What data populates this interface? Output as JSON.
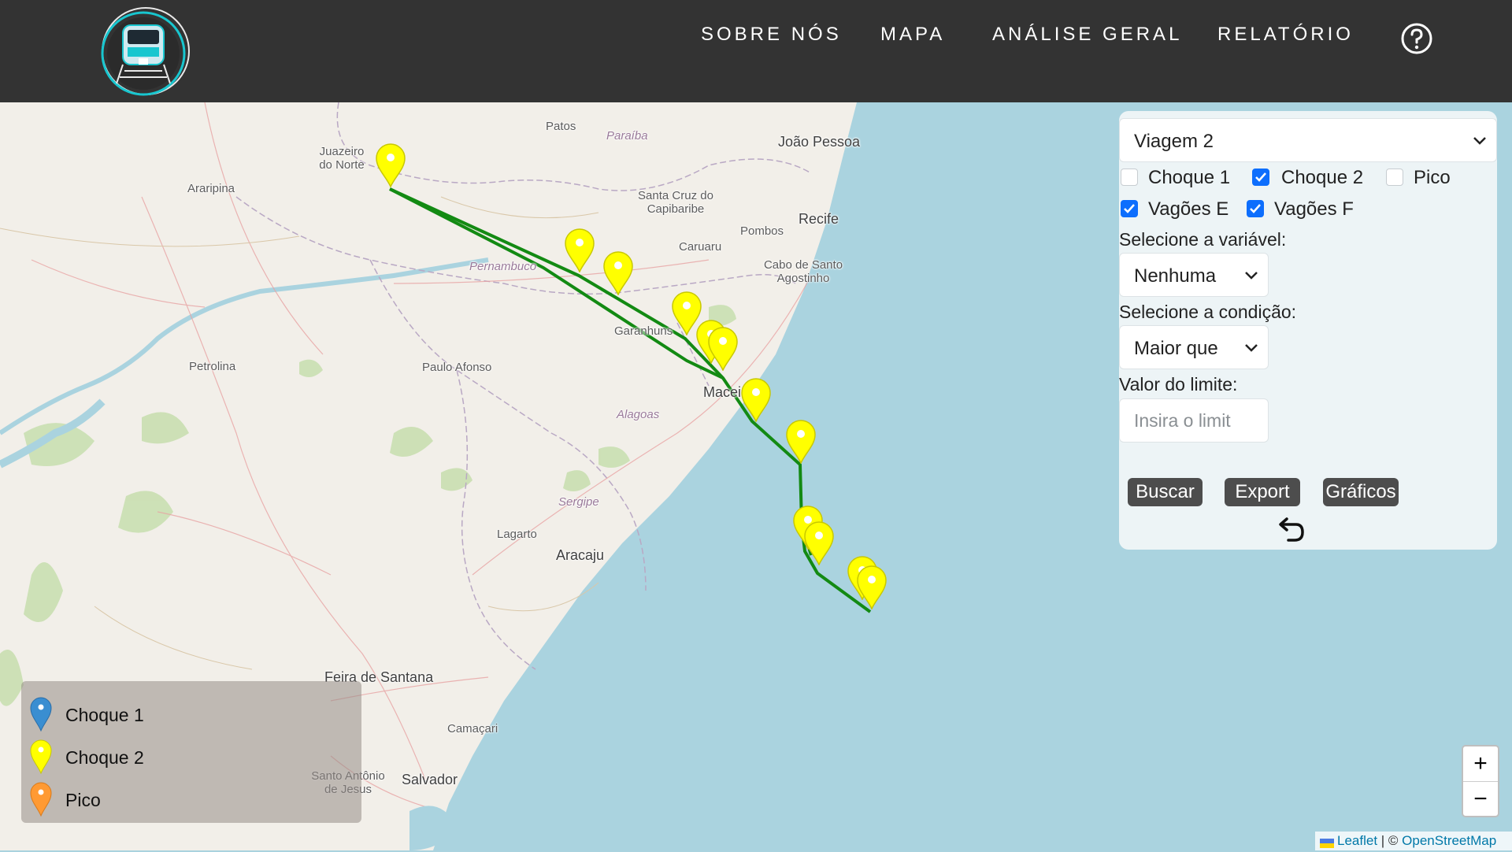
{
  "nav": {
    "items": [
      "SOBRE NÓS",
      "MAPA",
      "ANÁLISE GERAL",
      "RELATÓRIO"
    ],
    "help_icon": "question-circle-icon",
    "logo_icon": "train-logo-icon"
  },
  "map": {
    "places": {
      "patos": "Patos",
      "paraiba": "Paraíba",
      "joao_pessoa": "João Pessoa",
      "juazeiro": "Juazeiro do Norte",
      "araripina": "Araripina",
      "santa_cruz": "Santa Cruz do Capibaribe",
      "recife": "Recife",
      "pombos": "Pombos",
      "caruaru": "Caruaru",
      "cabo": "Cabo de Santo Agostinho",
      "pernambuco": "Pernambuco",
      "garanhuns": "Garanhuns",
      "petrolina": "Petrolina",
      "paulo_afonso": "Paulo Afonso",
      "maceio": "Maceió",
      "alagoas": "Alagoas",
      "sergipe": "Sergipe",
      "lagarto": "Lagarto",
      "aracaju": "Aracaju",
      "feira": "Feira de Santana",
      "camacari": "Camaçari",
      "santo_antonio": "Santo Antônio de Jesus",
      "salvador": "Salvador"
    },
    "route_color": "#138a13",
    "marker_colors": {
      "choque1": "#3a8ed1",
      "choque2": "#ffff00",
      "pico": "#ff9a33"
    }
  },
  "panel": {
    "trip_select": "Viagem 2",
    "checkboxes": [
      {
        "label": "Choque 1",
        "checked": false
      },
      {
        "label": "Choque 2",
        "checked": true
      },
      {
        "label": "Pico",
        "checked": false
      },
      {
        "label": "Vagões E",
        "checked": true
      },
      {
        "label": "Vagões F",
        "checked": true
      }
    ],
    "variable_label": "Selecione a variável:",
    "variable_value": "Nenhuma",
    "condition_label": "Selecione a condição:",
    "condition_value": "Maior que",
    "limit_label": "Valor do limite:",
    "limit_placeholder": "Insira o limit",
    "limit_value": "",
    "buttons": {
      "search": "Buscar",
      "export": "Export",
      "charts": "Gráficos"
    },
    "undo_icon": "undo-arrow-icon"
  },
  "legend": {
    "items": [
      "Choque 1",
      "Choque 2",
      "Pico"
    ]
  },
  "zoom": {
    "in": "+",
    "out": "−"
  },
  "attribution": {
    "leaflet": "Leaflet",
    "separator": " | © ",
    "osm": "OpenStreetMap"
  }
}
